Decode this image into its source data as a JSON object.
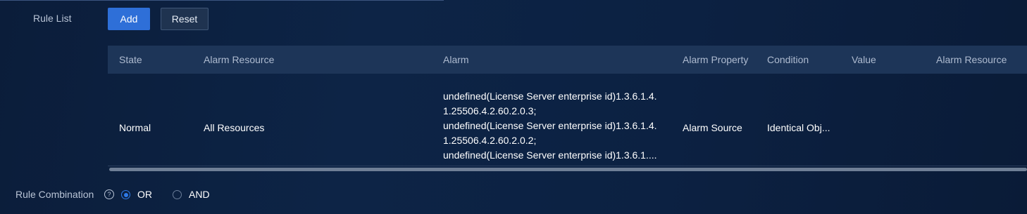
{
  "rule_list": {
    "label": "Rule List",
    "add_label": "Add",
    "reset_label": "Reset"
  },
  "table": {
    "columns": [
      "State",
      "Alarm Resource",
      "Alarm",
      "Alarm Property",
      "Condition",
      "Value",
      "Alarm Resource"
    ],
    "rows": [
      {
        "state": "Normal",
        "alarm_resource": "All Resources",
        "alarm_lines": [
          "undefined(License Server enterprise id)1.3.6.1.4.",
          "1.25506.4.2.60.2.0.3;",
          "undefined(License Server enterprise id)1.3.6.1.4.",
          "1.25506.4.2.60.2.0.2;",
          "undefined(License Server enterprise id)1.3.6.1...."
        ],
        "alarm_property": "Alarm Source",
        "condition": "Identical Obj...",
        "value": "",
        "alarm_resource_2": ""
      }
    ]
  },
  "rule_combination": {
    "label": "Rule Combination",
    "help_icon": "question-circle-icon",
    "options": [
      {
        "label": "OR",
        "checked": true
      },
      {
        "label": "AND",
        "checked": false
      }
    ]
  },
  "colors": {
    "accent": "#2e6fd8",
    "background": "#0c2142",
    "header_row": "#1d3558"
  }
}
